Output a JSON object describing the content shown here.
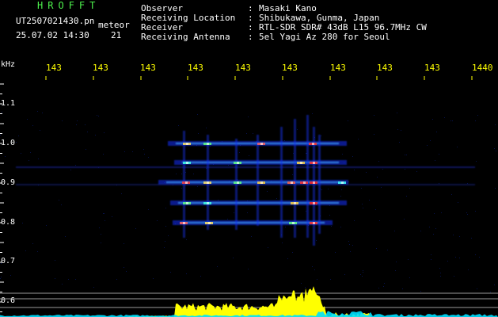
{
  "header": {
    "app_title": "HROFFT",
    "file_name": "UT2507021430.pn",
    "label": "meteor",
    "timestamp": "25.07.02 14:30",
    "count": "21"
  },
  "info": [
    {
      "key": "Observer",
      "sep": ":",
      "value": "Masaki Kano"
    },
    {
      "key": "Receiving Location",
      "sep": ":",
      "value": "Shibukawa, Gunma, Japan"
    },
    {
      "key": "Receiver",
      "sep": ":",
      "value": "RTL-SDR SDR# 43dB L15 96.7MHz CW"
    },
    {
      "key": "Receiving Antenna",
      "sep": ":",
      "value": "5el Yagi Az 280 for Seoul"
    }
  ],
  "time_axis": {
    "labels": [
      "143",
      "143",
      "143",
      "143",
      "143",
      "143",
      "143",
      "143",
      "143",
      "1440"
    ]
  },
  "freq_axis": {
    "unit": "kHz",
    "labels": [
      "1.1",
      "1.0",
      "0.9",
      "0.8",
      "0.7",
      "0.6"
    ]
  },
  "colors": {
    "background": "#000000",
    "text_white": "#ffffff",
    "title_green": "#4cf04c",
    "axis_yellow": "#ffff00",
    "spectrum_yellow": "#ffff00",
    "spectrum_cyan": "#00e0ff",
    "grid_gray": "#808080",
    "signal_blue": "#1030ff",
    "signal_red": "#ff2020"
  }
}
